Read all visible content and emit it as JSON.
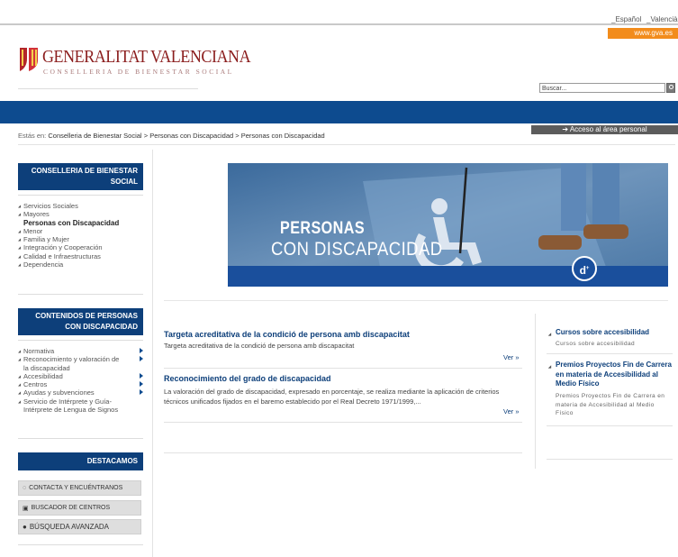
{
  "top": {
    "languages": [
      "_Español",
      "_Valencià"
    ],
    "gva_link": "www.gva.es"
  },
  "header": {
    "logo_title": "GENERALITAT VALENCIANA",
    "logo_subtitle": "CONSELLERIA DE BIENESTAR SOCIAL",
    "search_placeholder": "Buscar..."
  },
  "breadcrumb": {
    "label": "Estás en:",
    "items": [
      "Conselleria de Bienestar Social",
      "Personas con Discapacidad",
      "Personas con Discapacidad"
    ],
    "separator": ">"
  },
  "access_button": "Acceso al área personal",
  "sidebar": {
    "section1": {
      "heading_line1": "CONSELLERIA DE BIENESTAR",
      "heading_line2": "SOCIAL",
      "items": [
        {
          "label": "Servicios Sociales"
        },
        {
          "label": "Mayores"
        },
        {
          "label": "Personas con Discapacidad",
          "active": true
        },
        {
          "label": "Menor"
        },
        {
          "label": "Familia y Mujer"
        },
        {
          "label": "Integración y Cooperación"
        },
        {
          "label": "Calidad e Infraestructuras"
        },
        {
          "label": "Dependencia"
        }
      ]
    },
    "section2": {
      "heading_line1": "CONTENIDOS DE PERSONAS",
      "heading_line2": "CON DISCAPACIDAD",
      "items": [
        "Normativa",
        "Reconocimiento y valoración de",
        "la discapacidad",
        "Accesibilidad",
        "Centros",
        "Ayudas y subvenciones",
        "Servicio de Intérprete y Guía-",
        "Intérprete de Lengua de Signos"
      ]
    },
    "section3": {
      "heading": "DESTACAMOS",
      "buttons": [
        "CONTACTA Y ENCUÉNTRANOS",
        "BUSCADOR DE CENTROS",
        "BÚSQUEDA AVANZADA"
      ]
    }
  },
  "banner": {
    "line1": "PERSONAS",
    "line2": "CON DISCAPACIDAD",
    "badge": "d"
  },
  "articles": [
    {
      "title": "Targeta acreditativa de la condició de persona amb discapacitat",
      "desc": "Targeta acreditativa de la condició de persona amb discapacitat",
      "more": "Ver »"
    },
    {
      "title": "Reconocimiento del grado de discapacidad",
      "desc": "La valoración del grado de discapacidad, expresado en porcentaje, se realiza mediante la aplicación de criterios técnicos unificados fijados en el baremo establecido por el Real Decreto 1971/1999,...",
      "more": "Ver »"
    }
  ],
  "right_items": [
    {
      "title": "Cursos sobre accesibilidad",
      "desc": "Cursos sobre accesibilidad"
    },
    {
      "title": "Premios Proyectos Fin de Carrera en materia de Accesibilidad al Medio Físico",
      "desc": "Premios Proyectos Fin de Carrera en materia de Accesibilidad al Medio Físico"
    }
  ],
  "colors": {
    "brand_blue": "#0d4b8f",
    "sidebar_heading": "#0d3f7a",
    "accent_orange": "#f28c1c",
    "logo_red": "#8b1d1d"
  }
}
